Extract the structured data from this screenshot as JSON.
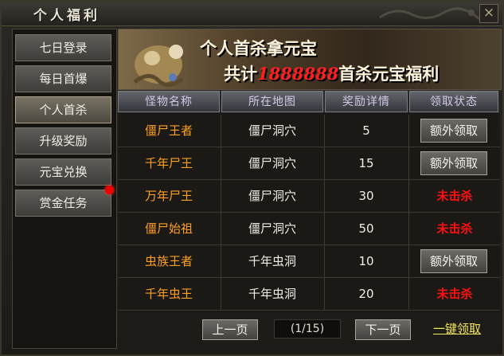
{
  "window": {
    "title": "个人福利"
  },
  "sidebar": {
    "items": [
      {
        "label": "七日登录"
      },
      {
        "label": "每日首爆"
      },
      {
        "label": "个人首杀"
      },
      {
        "label": "升级奖励"
      },
      {
        "label": "元宝兑换"
      },
      {
        "label": "赏金任务"
      }
    ],
    "active_index": 2
  },
  "banner": {
    "line1": "个人首杀拿元宝",
    "line2_prefix": "共计",
    "line2_number": "1888888",
    "line2_suffix": "首杀元宝福利"
  },
  "table": {
    "headers": [
      "怪物名称",
      "所在地图",
      "奖励详情",
      "领取状态"
    ],
    "rows": [
      {
        "name": "僵尸王者",
        "map": "僵尸洞穴",
        "reward": "5",
        "status": "额外领取"
      },
      {
        "name": "千年尸王",
        "map": "僵尸洞穴",
        "reward": "15",
        "status": "额外领取"
      },
      {
        "name": "万年尸王",
        "map": "僵尸洞穴",
        "reward": "30",
        "status": "未击杀"
      },
      {
        "name": "僵尸始祖",
        "map": "僵尸洞穴",
        "reward": "50",
        "status": "未击杀"
      },
      {
        "name": "虫族王者",
        "map": "千年虫洞",
        "reward": "10",
        "status": "额外领取"
      },
      {
        "name": "千年虫王",
        "map": "千年虫洞",
        "reward": "20",
        "status": "未击杀"
      }
    ]
  },
  "footer": {
    "prev_label": "上一页",
    "page_indicator": "(1/15)",
    "next_label": "下一页",
    "one_key_label": "一键领取"
  },
  "colors": {
    "name_orange": "#ff9f24",
    "not_killed_red": "#ff1010",
    "highlight_yellow": "#f2e65c"
  }
}
